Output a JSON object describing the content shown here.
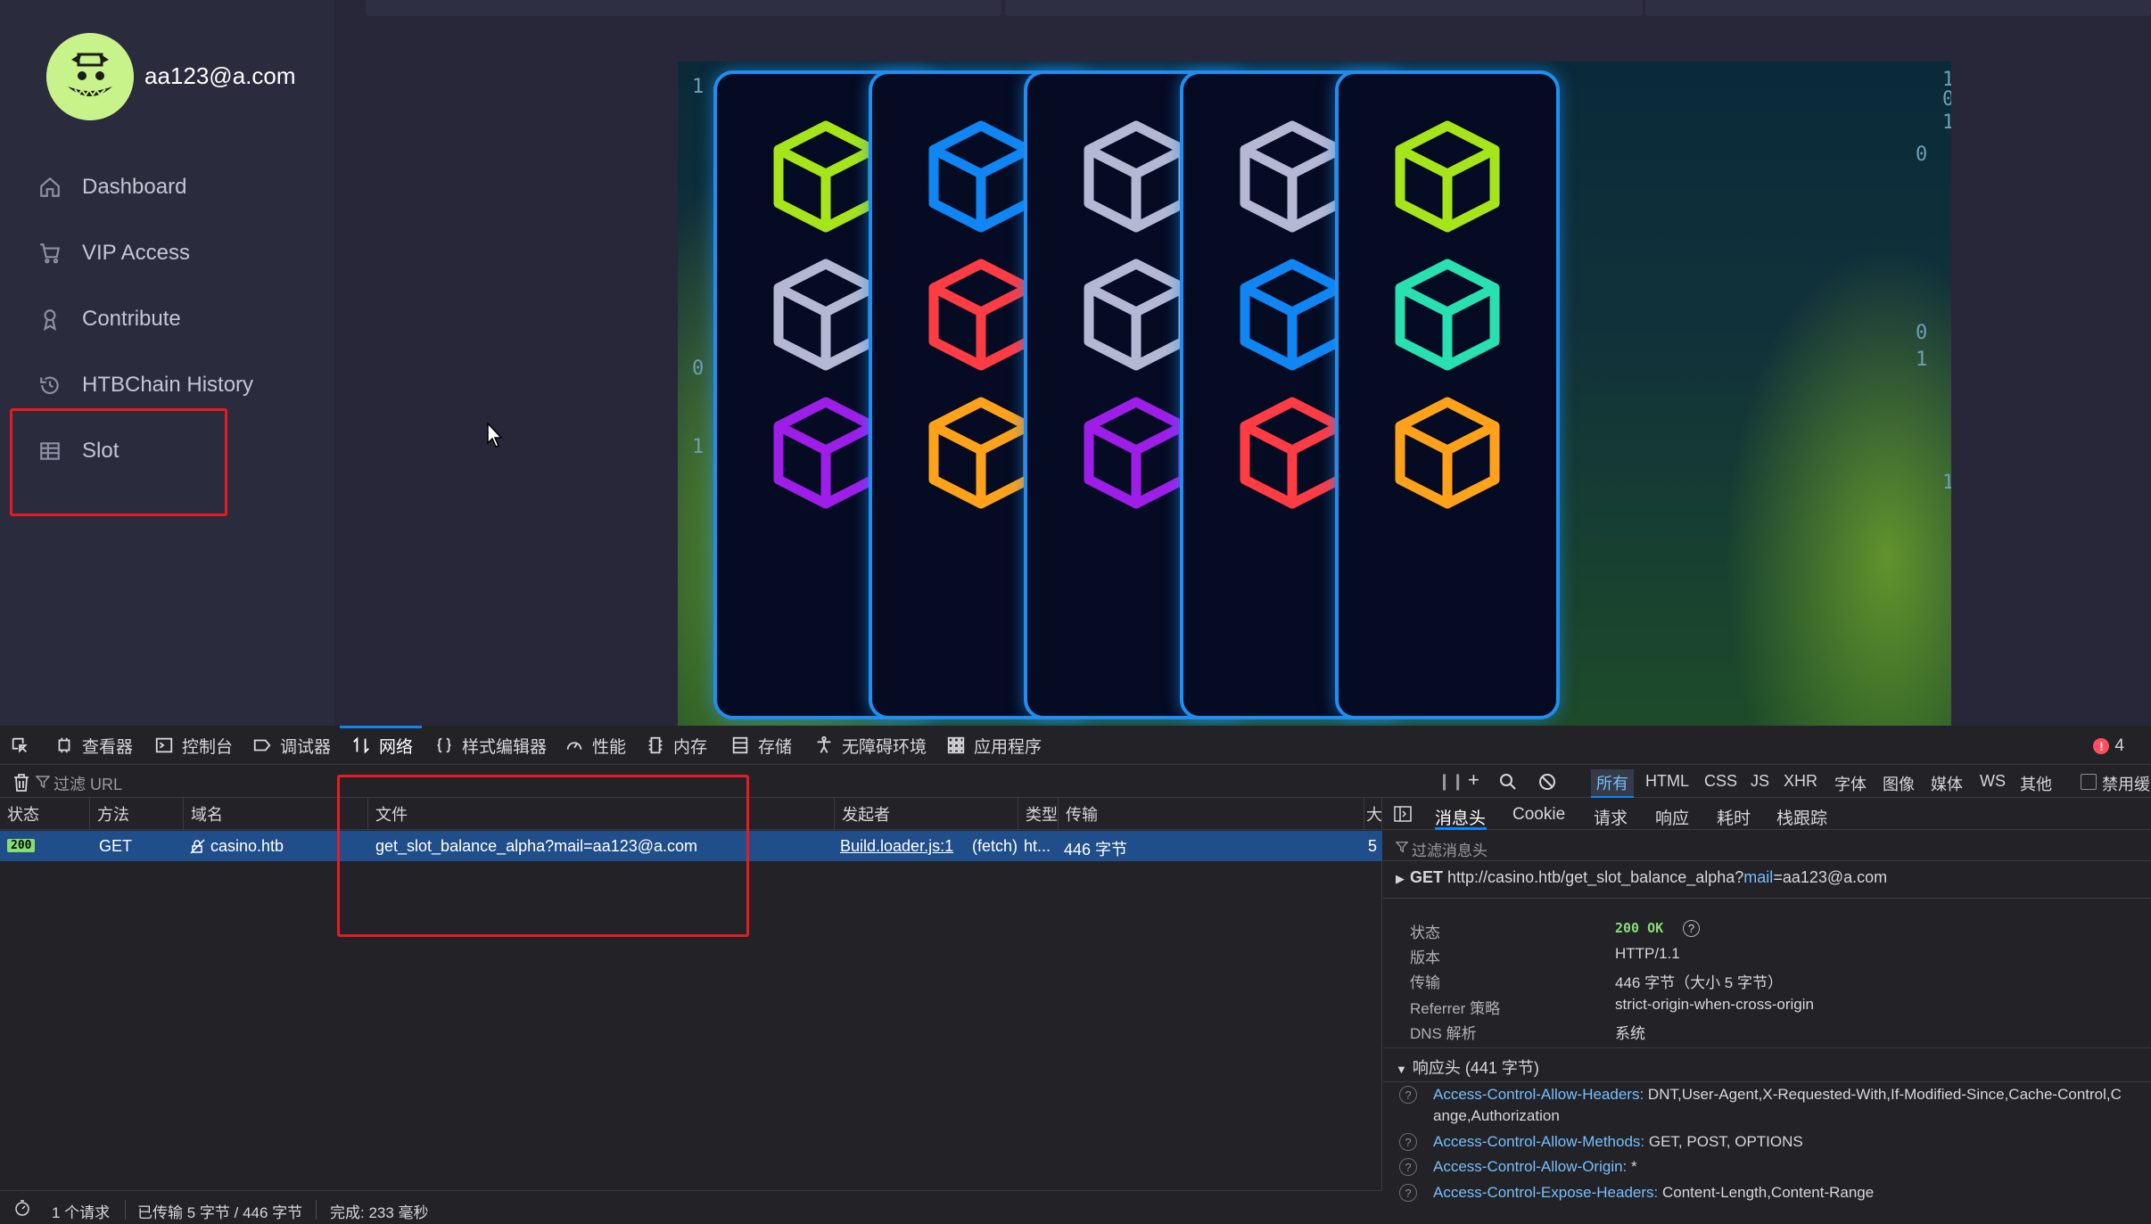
{
  "user": {
    "email": "aa123@a.com"
  },
  "sidebar": {
    "items": [
      {
        "label": "Dashboard",
        "icon": "home-icon"
      },
      {
        "label": "VIP Access",
        "icon": "cart-icon"
      },
      {
        "label": "Contribute",
        "icon": "contribute-icon"
      },
      {
        "label": "HTBChain History",
        "icon": "history-icon"
      },
      {
        "label": "Slot",
        "icon": "table-icon"
      }
    ]
  },
  "game": {
    "reels": [
      [
        "#a6e51a",
        "#b4b8d4",
        "#9f1de9"
      ],
      [
        "#0f86f4",
        "#ff3b44",
        "#ffa21a"
      ],
      [
        "#b4b8d4",
        "#b4b8d4",
        "#9f1de9"
      ],
      [
        "#b4b8d4",
        "#0f86f4",
        "#ff3b44"
      ],
      [
        "#a6e51a",
        "#28e0b0",
        "#ffa21a"
      ]
    ],
    "bg_digits": [
      "1",
      "0",
      "1",
      "1",
      "0",
      "1",
      "0",
      "0",
      "1",
      "1"
    ]
  },
  "devtools": {
    "tabs": [
      "查看器",
      "控制台",
      "调试器",
      "网络",
      "样式编辑器",
      "性能",
      "内存",
      "存储",
      "无障碍环境",
      "应用程序"
    ],
    "error_count": "4",
    "filter_url_placeholder": "过滤 URL",
    "type_filters": [
      "所有",
      "HTML",
      "CSS",
      "JS",
      "XHR",
      "字体",
      "图像",
      "媒体",
      "WS",
      "其他"
    ],
    "disable_cache": "禁用缓",
    "columns": [
      "状态",
      "方法",
      "域名",
      "文件",
      "发起者",
      "类型",
      "传输",
      "大"
    ],
    "request": {
      "status": "200",
      "method": "GET",
      "domain": "casino.htb",
      "file": "get_slot_balance_alpha?mail=aa123@a.com",
      "initiator": "Build.loader.js:1",
      "initiator_suffix": "(fetch)",
      "type": "ht...",
      "transferred": "446 字节",
      "size": "5"
    },
    "status_bar": {
      "requests": "1 个请求",
      "transferred": "已传输 5 字节 / 446 字节",
      "finish": "完成: 233 毫秒"
    },
    "detail": {
      "tabs": [
        "消息头",
        "Cookie",
        "请求",
        "响应",
        "耗时",
        "栈跟踪"
      ],
      "filter_placeholder": "过滤消息头",
      "method": "GET",
      "url_prefix": "http://casino.htb/get_slot_balance_alpha?",
      "url_param_key": "mail",
      "url_param_val": "=aa123@a.com",
      "fields": [
        {
          "k": "状态",
          "v": "200 OK"
        },
        {
          "k": "版本",
          "v": "HTTP/1.1"
        },
        {
          "k": "传输",
          "v": "446 字节（大小 5 字节）"
        },
        {
          "k": "Referrer 策略",
          "v": "strict-origin-when-cross-origin"
        },
        {
          "k": "DNS 解析",
          "v": "系统"
        }
      ],
      "response_headers_title": "响应头 (441 字节)",
      "headers": [
        {
          "k": "Access-Control-Allow-Headers:",
          "v": "DNT,User-Agent,X-Requested-With,If-Modified-Since,Cache-Control,C",
          "v2": "ange,Authorization"
        },
        {
          "k": "Access-Control-Allow-Methods:",
          "v": "GET, POST, OPTIONS"
        },
        {
          "k": "Access-Control-Allow-Origin:",
          "v": "*"
        },
        {
          "k": "Access-Control-Expose-Headers:",
          "v": "Content-Length,Content-Range"
        }
      ]
    }
  },
  "colors": {
    "highlight": "#e81b24",
    "accent": "#0a84ff",
    "row_selected": "#204e8a"
  }
}
